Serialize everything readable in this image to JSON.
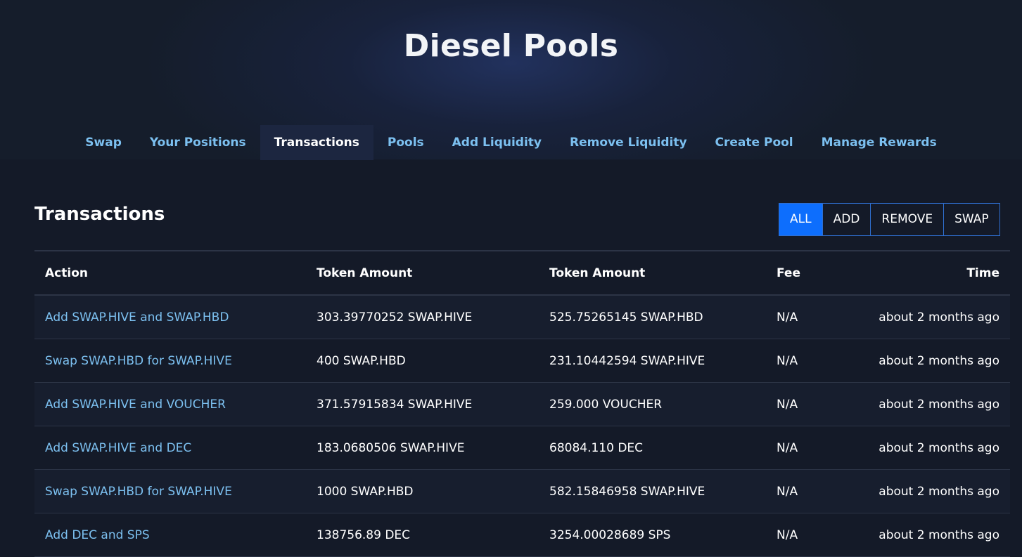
{
  "header": {
    "title": "Diesel Pools"
  },
  "nav": {
    "tabs": [
      {
        "label": "Swap"
      },
      {
        "label": "Your Positions"
      },
      {
        "label": "Transactions"
      },
      {
        "label": "Pools"
      },
      {
        "label": "Add Liquidity"
      },
      {
        "label": "Remove Liquidity"
      },
      {
        "label": "Create Pool"
      },
      {
        "label": "Manage Rewards"
      }
    ],
    "active_tab": "Transactions"
  },
  "section": {
    "title": "Transactions"
  },
  "filters": {
    "options": [
      {
        "label": "ALL"
      },
      {
        "label": "ADD"
      },
      {
        "label": "REMOVE"
      },
      {
        "label": "SWAP"
      }
    ],
    "selected": "ALL"
  },
  "table": {
    "columns": [
      "Action",
      "Token Amount",
      "Token Amount",
      "Fee",
      "Time"
    ],
    "rows": [
      {
        "action": "Add SWAP.HIVE and SWAP.HBD",
        "amount1": "303.39770252 SWAP.HIVE",
        "amount2": "525.75265145 SWAP.HBD",
        "fee": "N/A",
        "time": "about 2 months ago"
      },
      {
        "action": "Swap SWAP.HBD for SWAP.HIVE",
        "amount1": "400 SWAP.HBD",
        "amount2": "231.10442594 SWAP.HIVE",
        "fee": "N/A",
        "time": "about 2 months ago"
      },
      {
        "action": "Add SWAP.HIVE and VOUCHER",
        "amount1": "371.57915834 SWAP.HIVE",
        "amount2": "259.000 VOUCHER",
        "fee": "N/A",
        "time": "about 2 months ago"
      },
      {
        "action": "Add SWAP.HIVE and DEC",
        "amount1": "183.0680506 SWAP.HIVE",
        "amount2": "68084.110 DEC",
        "fee": "N/A",
        "time": "about 2 months ago"
      },
      {
        "action": "Swap SWAP.HBD for SWAP.HIVE",
        "amount1": "1000 SWAP.HBD",
        "amount2": "582.15846958 SWAP.HIVE",
        "fee": "N/A",
        "time": "about 2 months ago"
      },
      {
        "action": "Add DEC and SPS",
        "amount1": "138756.89 DEC",
        "amount2": "3254.00028689 SPS",
        "fee": "N/A",
        "time": "about 2 months ago"
      }
    ]
  },
  "colors": {
    "background": "#141a28",
    "link": "#7cc0f0",
    "accent": "#0d6efd"
  }
}
